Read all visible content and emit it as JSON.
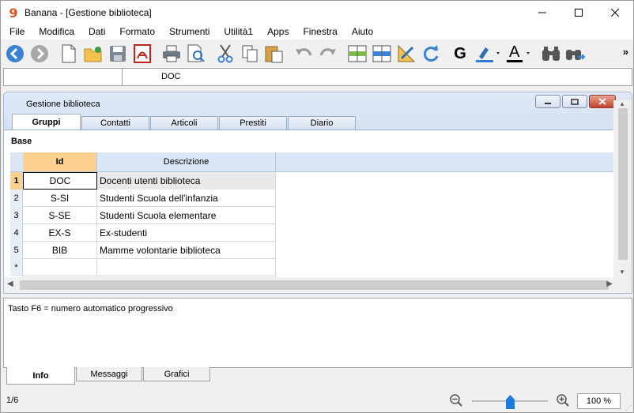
{
  "window": {
    "title": "Banana - [Gestione biblioteca]",
    "logo_glyph": "9",
    "controls": {
      "minimize": "—",
      "maximize": "☐",
      "close": "✕"
    }
  },
  "menu": [
    "File",
    "Modifica",
    "Dati",
    "Formato",
    "Strumenti",
    "Utilità1",
    "Apps",
    "Finestra",
    "Aiuto"
  ],
  "toolbar": {
    "icons": [
      "back-icon",
      "forward-icon",
      "new-file-icon",
      "open-folder-icon",
      "save-icon",
      "pdf-icon",
      "print-icon",
      "print-preview-icon",
      "cut-icon",
      "copy-icon",
      "paste-icon",
      "undo-icon",
      "redo-icon",
      "insert-row-icon",
      "delete-row-icon",
      "edit-ruler-icon",
      "refresh-icon",
      "bold-icon",
      "highlight-icon",
      "font-color-icon",
      "find-icon",
      "find-replace-icon"
    ],
    "more": "»",
    "bold_glyph": "G",
    "font_color_glyph": "A",
    "accent_color": "#2f7bd6"
  },
  "cell_editor": {
    "address": "",
    "value": "DOC"
  },
  "document": {
    "title": "Gestione biblioteca",
    "tabs": [
      "Gruppi",
      "Contatti",
      "Articoli",
      "Prestiti",
      "Diario"
    ],
    "active_tab": "Gruppi",
    "section": "Base",
    "columns": [
      "Id",
      "Descrizione"
    ],
    "rows": [
      {
        "num": "1",
        "id": "DOC",
        "desc": "Docenti utenti biblioteca"
      },
      {
        "num": "2",
        "id": "S-SI",
        "desc": "Studenti Scuola dell'infanzia"
      },
      {
        "num": "3",
        "id": "S-SE",
        "desc": "Studenti Scuola elementare"
      },
      {
        "num": "4",
        "id": "EX-S",
        "desc": "Ex-studenti"
      },
      {
        "num": "5",
        "id": "BIB",
        "desc": "Mamme volontarie biblioteca"
      },
      {
        "num": "*",
        "id": "",
        "desc": ""
      }
    ],
    "header_highlight_color": "#fbd18d"
  },
  "info_panel": {
    "text": "Tasto F6 = numero automatico progressivo",
    "tabs": [
      "Info",
      "Messaggi",
      "Grafici"
    ],
    "active_tab": "Info"
  },
  "status": {
    "row_position": "1/6",
    "zoom": "100 %"
  }
}
